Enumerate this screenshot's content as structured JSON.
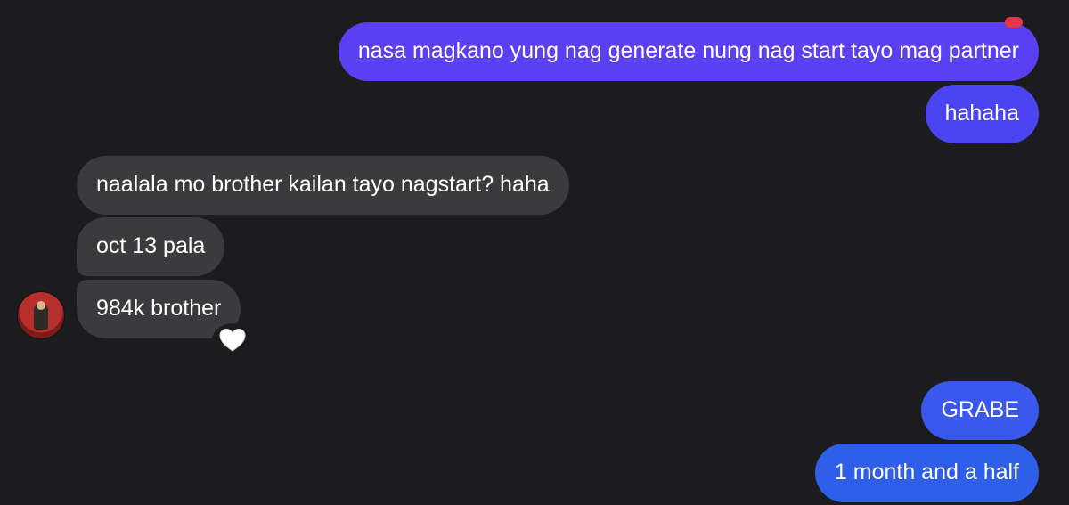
{
  "messages": [
    {
      "text": "nasa magkano yung nag generate nung nag start tayo mag partner",
      "direction": "outgoing",
      "color": "#5b3ff2"
    },
    {
      "text": "hahaha",
      "direction": "outgoing",
      "color": "#4a44f2"
    },
    {
      "text": "naalala mo brother kailan tayo nagstart? haha",
      "direction": "incoming",
      "color": "#3b3b3d"
    },
    {
      "text": "oct 13 pala",
      "direction": "incoming",
      "color": "#3b3b3d"
    },
    {
      "text": "984k brother",
      "direction": "incoming",
      "color": "#3b3b3d",
      "reaction": "white-heart"
    },
    {
      "text": "GRABE",
      "direction": "outgoing",
      "color": "#3a57ee"
    },
    {
      "text": "1 month and a half",
      "direction": "outgoing",
      "color": "#2f5fea"
    }
  ],
  "icons": {
    "top_reaction": "red-heart-icon",
    "avatar": "avatar",
    "reaction": "white-heart-icon"
  }
}
